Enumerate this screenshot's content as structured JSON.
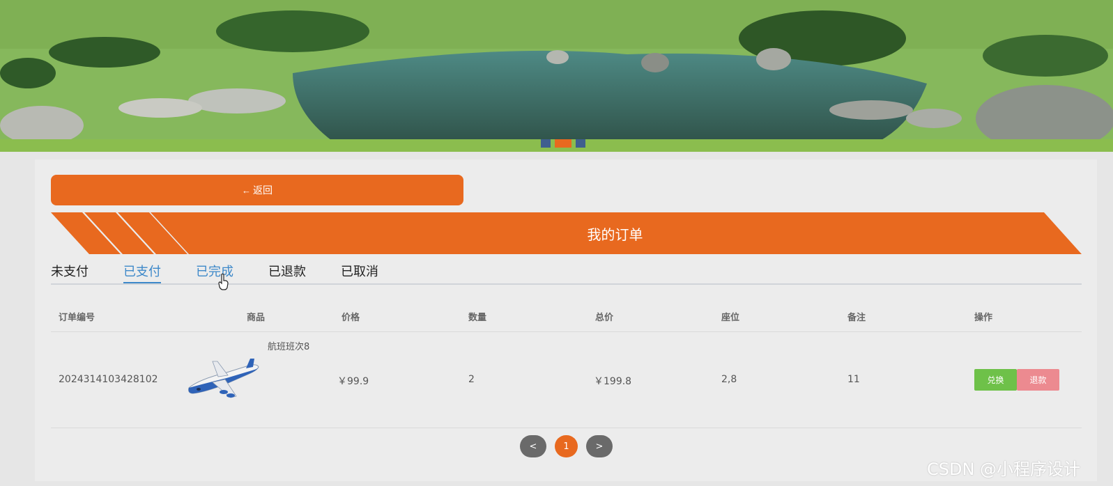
{
  "banner": {
    "indicators": 3,
    "active_index": 1
  },
  "back_button": {
    "label": "返回"
  },
  "page_title": "我的订单",
  "tabs": [
    {
      "label": "未支付",
      "state": "normal"
    },
    {
      "label": "已支付",
      "state": "active"
    },
    {
      "label": "已完成",
      "state": "hover"
    },
    {
      "label": "已退款",
      "state": "normal"
    },
    {
      "label": "已取消",
      "state": "normal"
    }
  ],
  "table": {
    "headers": [
      "订单编号",
      "商品",
      "价格",
      "数量",
      "总价",
      "座位",
      "备注",
      "操作"
    ],
    "rows": [
      {
        "order_no": "2024314103428102",
        "product_name": "航班班次8",
        "product_image": "airplane-image",
        "price": "￥99.9",
        "quantity": "2",
        "total": "￥199.8",
        "seat": "2,8",
        "remark": "11",
        "actions": [
          "兑换",
          "退款"
        ]
      }
    ]
  },
  "pagination": {
    "prev": "<",
    "current": "1",
    "next": ">"
  },
  "watermark": "CSDN @小程序设计",
  "colors": {
    "accent": "#e8691f",
    "tab_active": "#3d88c9",
    "btn_exchange": "#6ec149",
    "btn_refund": "#ec8a90"
  }
}
